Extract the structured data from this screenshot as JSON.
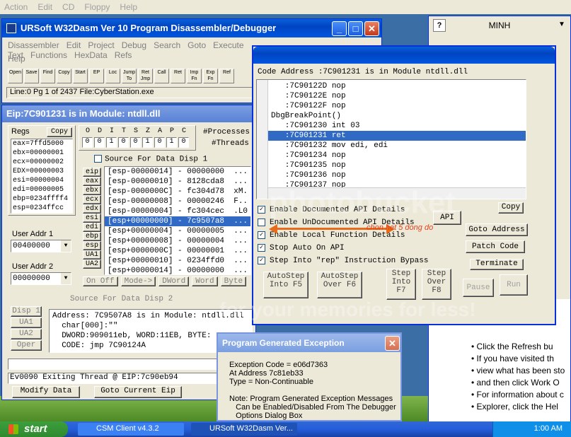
{
  "top_menu": {
    "items": [
      "Action",
      "Edit",
      "CD",
      "Floppy",
      "Help"
    ]
  },
  "main": {
    "title": "URSoft W32Dasm Ver 10   Program Disassembler/Debugger",
    "menu": [
      "Disassembler",
      "Edit",
      "Project",
      "Debug",
      "Search",
      "Goto",
      "Execute Text",
      "Functions",
      "HexData",
      "Refs"
    ],
    "menu2": [
      "Help"
    ],
    "toolbar": [
      "Open",
      "Save",
      "Find",
      "Copy",
      "Start",
      "EP",
      "Loc",
      "Jump To",
      "Ret Jmp",
      "Call",
      "Ret",
      "Imp Fn",
      "Exp Fn",
      "Ref"
    ],
    "status": "Line:0 Pg 1 of 2437  File:CyberStation.exe"
  },
  "debug": {
    "title": "Eip:7C901231 is in Module: ntdll.dll",
    "regs_label": "Regs",
    "copy_label": "Copy",
    "regs": [
      "eax=7ffd5000",
      "ebx=00000001",
      "ecx=00000002",
      "EDX=00000003",
      "esi=00000004",
      "edi=00000005",
      "ebp=0234ffff4",
      "esp=0234ffcc"
    ],
    "flags_letters": [
      "O",
      "D",
      "I",
      "T",
      "S",
      "Z",
      "A",
      "P",
      "C"
    ],
    "flags_values": [
      "0",
      "0",
      "1",
      "0",
      "0",
      "1",
      "0",
      "1",
      "0"
    ],
    "processes": "#Processes",
    "threads": "#Threads",
    "user_addr1_label": "User Addr 1",
    "user_addr1": "00400000",
    "user_addr2_label": "User Addr 2",
    "user_addr2": "00000000",
    "source1_label": "Source For Data Disp 1",
    "src_buttons": [
      "eip",
      "eax",
      "ebx",
      "ecx",
      "edx",
      "esi",
      "edi",
      "ebp",
      "esp",
      "UA1",
      "UA2"
    ],
    "stack": [
      "[esp-00000014] - 00000000  ...",
      "[esp-00000010] - 8128cda8  ...",
      "[esp-0000000C] - fc304d78  xM.",
      "[esp-00000008] - 00000246  F..",
      "[esp-00000004] - fc304cec  .L0",
      "[esp+00000000] - 7c9507a8  ...",
      "[esp+00000004] - 00000005  ...",
      "[esp+00000008] - 00000004  ...",
      "[esp+0000000C] - 00000001  ...",
      "[esp+00000010] - 0234ffd0  ...",
      "[esp+00000014] - 00000000  ..."
    ],
    "stack_selected": 5,
    "disp_buttons": [
      "On Off",
      "Mode->",
      "DWord",
      "Word",
      "Byte"
    ],
    "source2_label": "Source For Data Disp 2",
    "disp2_buttons": [
      "Disp 1",
      "UA1",
      "UA2",
      "Oper"
    ],
    "disp2_lines": [
      "Address: 7C9507A8 is in Module: ntdll.dll",
      "  char[000]:\"\"",
      "  DWORD:909011eb, WORD:11EB, BYTE:",
      "  CODE: jmp 7C90124A"
    ],
    "status_line": "Ev0090 Exiting Thread @ EIP:7c90eb94",
    "modify_btn": "Modify Data",
    "goto_eip_btn": "Goto Current Eip"
  },
  "code": {
    "header": "Code Address :7C901231 is in Module ntdll.dll",
    "lines": [
      "   :7C90122D nop",
      "   :7C90122E nop",
      "   :7C90122F nop",
      "DbgBreakPoint()",
      "   :7C901230 int 03",
      "   :7C901231 ret",
      "   :7C901232 mov edi, edi",
      "   :7C901234 nop",
      "   :7C901235 nop",
      "   :7C901236 nop",
      "   :7C901237 nop"
    ],
    "selected": 5,
    "options": [
      {
        "label": "Enable Documented API Details",
        "checked": true
      },
      {
        "label": "Enable UnDocumented API Details",
        "checked": false
      },
      {
        "label": "Enable Local Function Details",
        "checked": true
      },
      {
        "label": "Stop Auto On API",
        "checked": true
      },
      {
        "label": "Step Into \"rep\" Instruction Bypass",
        "checked": true
      }
    ],
    "api_btn": "API",
    "copy_btn": "Copy",
    "goto_btn": "Goto Address",
    "patch_btn": "Patch Code",
    "terminate_btn": "Terminate",
    "pause_btn": "Pause",
    "run_btn": "Run",
    "autostep_into": "AutoStep Into F5",
    "autostep_over": "AutoStep Over F6",
    "step_into": "Step Into F7",
    "step_over": "Step Over F8",
    "annotation": "chon het 5 dong do"
  },
  "exception": {
    "title": "Program Generated Exception",
    "lines": [
      "Exception Code = e06d7363",
      "At Address 7c81eb33",
      "Type = Non-Continuable",
      "",
      "Note: Program Generated Exception Messages",
      "   Can be Enabled/Disabled From The Debugger",
      "   Options Dialog Box"
    ]
  },
  "side": {
    "title": "MINH",
    "help_lines": [
      "Click the  Refresh bu",
      "If you have visited th",
      "view what has been sto",
      "and then click Work O",
      "For information about c",
      "Explorer, click the Hel"
    ]
  },
  "watermark": [
    "photobucket",
    "for your memories for less!"
  ],
  "taskbar": {
    "start": "start",
    "items": [
      "CSM Client v4.3.2",
      "URSoft W32Dasm Ver..."
    ],
    "clock": "1:00 AM"
  }
}
